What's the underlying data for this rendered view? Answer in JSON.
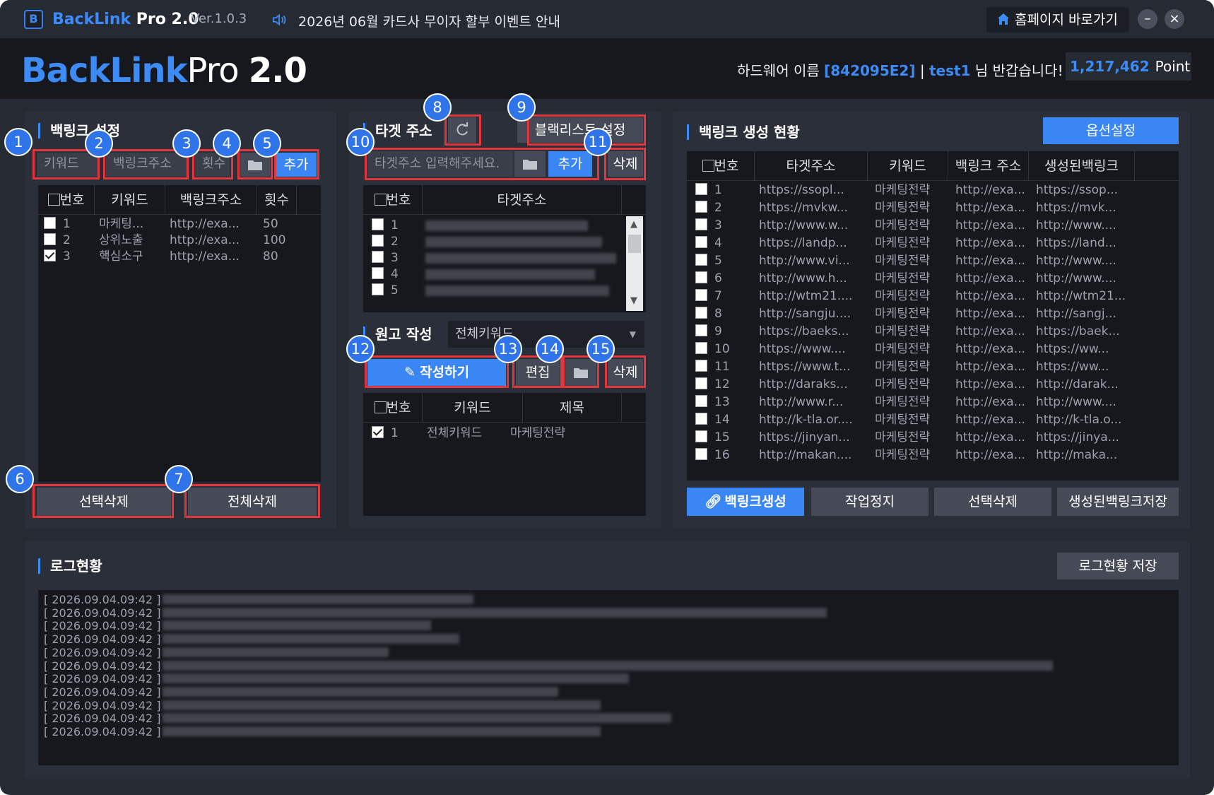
{
  "titlebar": {
    "app_name_b": "BackLink",
    "app_name_rest": " Pro 2.0",
    "version": "Ver.1.0.3",
    "notice": "2026년 06월 카드사 무이자 할부 이벤트 안내",
    "home_button": "홈페이지 바로가기",
    "minimize": "–",
    "close": "×"
  },
  "header": {
    "brand_part1": "BackLink",
    "brand_part2": "Pro ",
    "brand_part3": "2.0",
    "greet_prefix": "하드웨어 이름 ",
    "hardware_id": "[842095E2]",
    "greet_sep": " | ",
    "user": "test1",
    "greet_suffix": " 님 반갑습니다!",
    "points": "1,217,462",
    "point_unit": "Point"
  },
  "backlink_settings": {
    "title": "백링크 설정",
    "keyword_placeholder": "키워드",
    "url_placeholder": "백링크주소",
    "count_placeholder": "횟수",
    "add_button": "추가",
    "columns": [
      "번호",
      "키워드",
      "백링크주소",
      "횟수"
    ],
    "rows": [
      {
        "no": "1",
        "keyword": "마케팅...",
        "url": "http://exa...",
        "count": "50",
        "checked": false
      },
      {
        "no": "2",
        "keyword": "상위노출",
        "url": "http://exa...",
        "count": "100",
        "checked": false
      },
      {
        "no": "3",
        "keyword": "핵심소구",
        "url": "http://exa...",
        "count": "80",
        "checked": true
      }
    ],
    "delete_selected": "선택삭제",
    "delete_all": "전체삭제"
  },
  "target": {
    "title": "타겟 주소",
    "blacklist_button": "블랙리스트 설정",
    "input_placeholder": "타겟주소 입력해주세요.",
    "add_button": "추가",
    "delete_button": "삭제",
    "columns": [
      "번호",
      "타겟주소"
    ],
    "row_numbers": [
      "1",
      "2",
      "3",
      "4",
      "5"
    ]
  },
  "manuscript": {
    "title": "원고 작성",
    "select_value": "전체키워드",
    "write_button": "작성하기",
    "edit_button": "편집",
    "delete_button": "삭제",
    "columns": [
      "번호",
      "키워드",
      "제목"
    ],
    "rows": [
      {
        "no": "1",
        "keyword": "전체키워드",
        "title": "마케팅전략",
        "checked": true
      }
    ]
  },
  "status": {
    "title": "백링크 생성 현황",
    "option_button": "옵션설정",
    "columns": [
      "번호",
      "타겟주소",
      "키워드",
      "백링크 주소",
      "생성된백링크"
    ],
    "rows": [
      {
        "no": "1",
        "target": "https://ssopl...",
        "keyword": "마케팅전략",
        "backlink": "http://exa...",
        "created": "https://ssop..."
      },
      {
        "no": "2",
        "target": "https://mvkw...",
        "keyword": "마케팅전략",
        "backlink": "http://exa...",
        "created": "https://mvk..."
      },
      {
        "no": "3",
        "target": "http://www.w...",
        "keyword": "마케팅전략",
        "backlink": "http://exa...",
        "created": "http://www...."
      },
      {
        "no": "4",
        "target": "https://landp...",
        "keyword": "마케팅전략",
        "backlink": "http://exa...",
        "created": "https://land..."
      },
      {
        "no": "5",
        "target": "http://www.vi...",
        "keyword": "마케팅전략",
        "backlink": "http://exa...",
        "created": "http://www...."
      },
      {
        "no": "6",
        "target": "http://www.h...",
        "keyword": "마케팅전략",
        "backlink": "http://exa...",
        "created": "http://www...."
      },
      {
        "no": "7",
        "target": "http://wtm21....",
        "keyword": "마케팅전략",
        "backlink": "http://exa...",
        "created": "http://wtm21..."
      },
      {
        "no": "8",
        "target": "http://sangju....",
        "keyword": "마케팅전략",
        "backlink": "http://exa...",
        "created": "http://sangj..."
      },
      {
        "no": "9",
        "target": "https://baeks...",
        "keyword": "마케팅전략",
        "backlink": "http://exa...",
        "created": "https://baek..."
      },
      {
        "no": "10",
        "target": "https://www....",
        "keyword": "마케팅전략",
        "backlink": "http://exa...",
        "created": "https://ww..."
      },
      {
        "no": "11",
        "target": "https://www.t...",
        "keyword": "마케팅전략",
        "backlink": "http://exa...",
        "created": "https://ww..."
      },
      {
        "no": "12",
        "target": "http://daraks...",
        "keyword": "마케팅전략",
        "backlink": "http://exa...",
        "created": "http://darak..."
      },
      {
        "no": "13",
        "target": "http://www.r...",
        "keyword": "마케팅전략",
        "backlink": "http://exa...",
        "created": "http://www...."
      },
      {
        "no": "14",
        "target": "http://k-tla.or....",
        "keyword": "마케팅전략",
        "backlink": "http://exa...",
        "created": "http://k-tla.o..."
      },
      {
        "no": "15",
        "target": "https://jinyan...",
        "keyword": "마케팅전략",
        "backlink": "http://exa...",
        "created": "https://jinya..."
      },
      {
        "no": "16",
        "target": "http://makan....",
        "keyword": "마케팅전략",
        "backlink": "http://exa...",
        "created": "http://maka..."
      }
    ],
    "generate_button": "백링크생성",
    "stop_button": "작업정지",
    "delete_selected": "선택삭제",
    "save_button": "생성된백링크저장"
  },
  "log": {
    "title": "로그현황",
    "save_button": "로그현황 저장",
    "entries": [
      "[ 2026.09.04.09:42 ]",
      "[ 2026.09.04.09:42 ]",
      "[ 2026.09.04.09:42 ]",
      "[ 2026.09.04.09:42 ]",
      "[ 2026.09.04.09:42 ]",
      "[ 2026.09.04.09:42 ]",
      "[ 2026.09.04.09:42 ]",
      "[ 2026.09.04.09:42 ]",
      "[ 2026.09.04.09:42 ]",
      "[ 2026.09.04.09:42 ]",
      "[ 2026.09.04.09:42 ]"
    ]
  },
  "callouts": [
    "1",
    "2",
    "3",
    "4",
    "5",
    "6",
    "7",
    "8",
    "9",
    "10",
    "11",
    "12",
    "13",
    "14",
    "15"
  ],
  "colors": {
    "accent": "#3a86f5",
    "highlight_box": "#e2363c",
    "background": "#262a33",
    "table_background": "#16181e"
  }
}
